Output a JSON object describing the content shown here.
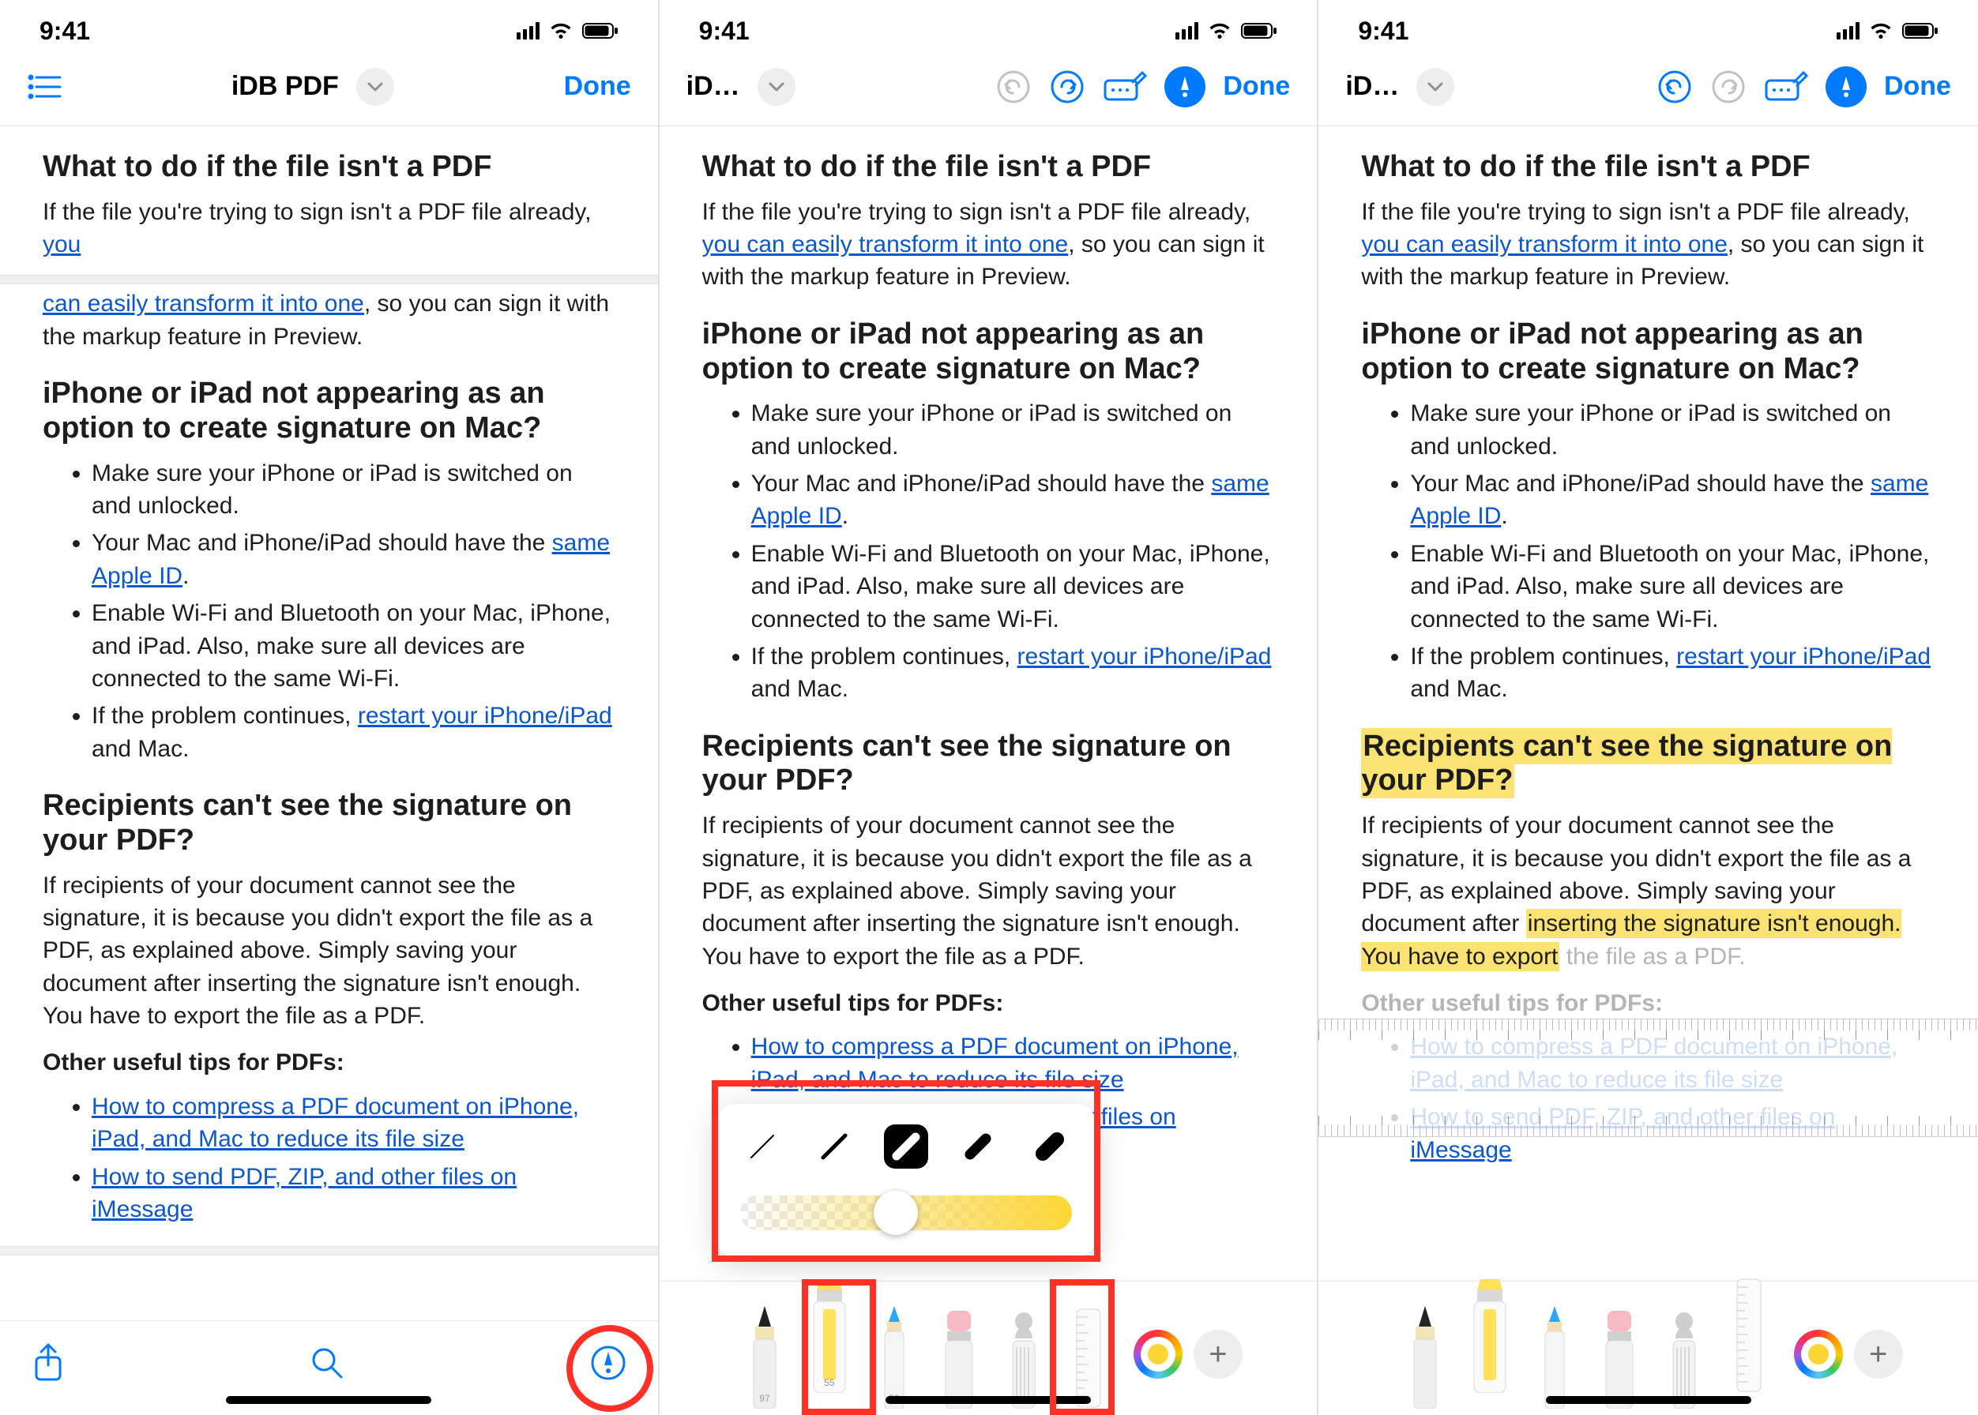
{
  "status": {
    "time": "9:41"
  },
  "nav": {
    "title_full": "iDB PDF",
    "title_trunc": "iD…",
    "done": "Done"
  },
  "doc": {
    "h_notpdf": "What to do if the file isn't a PDF",
    "p_notpdf_pre": "If the file you're trying to sign isn't a PDF file already, ",
    "a_transform": "you can easily transform it into one",
    "p_notpdf_post": ", so you can sign it with the markup feature in Preview.",
    "h_iphone": "iPhone or iPad not appearing as an option to create signature on Mac?",
    "li1": "Make sure your iPhone or iPad is switched on and unlocked.",
    "li2_pre": "Your Mac and iPhone/iPad should have the ",
    "li2_a": "same Apple ID",
    "li2_post": ".",
    "li3": "Enable Wi-Fi and Bluetooth on your Mac, iPhone, and iPad. Also, make sure all devices are connected to the same Wi-Fi.",
    "li4_pre": "If the problem continues, ",
    "li4_a": "restart your iPhone/iPad",
    "li4_post": " and Mac.",
    "h_recip": "Recipients can't see the signature on your PDF?",
    "p_recip": "If recipients of your document cannot see the signature, it is because you didn't export the file as a PDF, as explained above. Simply saving your document after inserting the signature isn't enough. You have to export the file as a PDF.",
    "p_recip_a": "If recipients of your document cannot see the signature, it is because you didn't export the file as a PDF, as explained above. Simply saving your document after",
    "p_recip_hl": "inserting the signature isn't enough. You have to export",
    "p_recip_c": "the file as a PDF.",
    "h_other": "Other useful tips for PDFs:",
    "a_compress": "How to compress a PDF document on iPhone, iPad, and Mac to reduce its file size",
    "a_send": "How to send PDF, ZIP, and other files on iMessage"
  },
  "tools": {
    "pen_label": "97",
    "hl_label": "55",
    "pencil_label": "50"
  }
}
